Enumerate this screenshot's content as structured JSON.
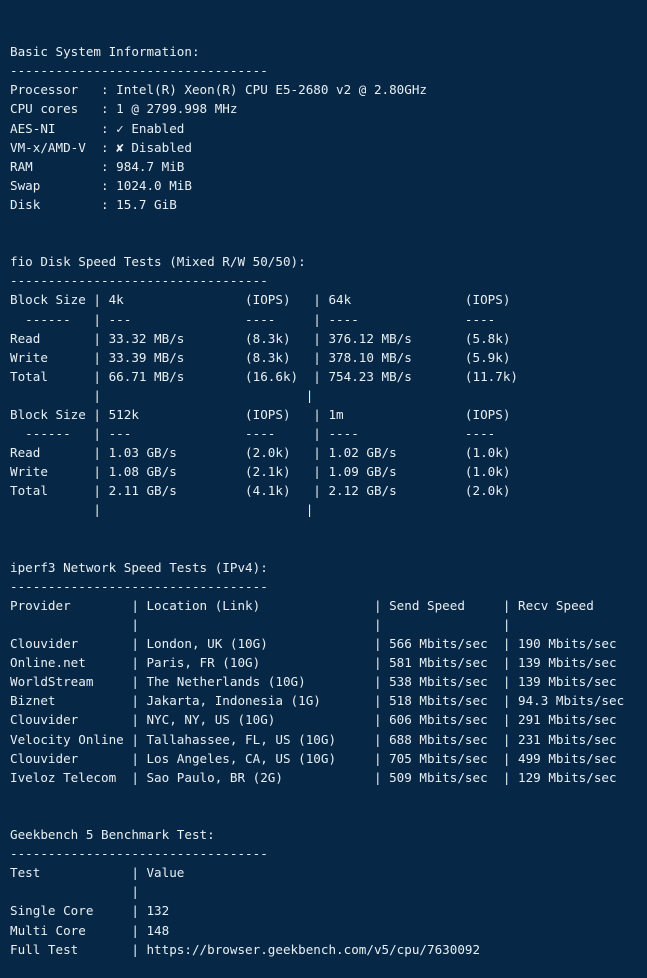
{
  "terminal": {
    "background_color": "#062846",
    "text_color": "#e9eff3",
    "rule_char": "-",
    "rule_length": 34,
    "pipe": "|"
  },
  "system_info": {
    "heading": "Basic System Information:",
    "rows": [
      {
        "label": "Processor",
        "value": "Intel(R) Xeon(R) CPU E5-2680 v2 @ 2.80GHz"
      },
      {
        "label": "CPU cores",
        "value": "1 @ 2799.998 MHz"
      },
      {
        "label": "AES-NI",
        "value": "Enabled",
        "glyph": "✓"
      },
      {
        "label": "VM-x/AMD-V",
        "value": "Disabled",
        "glyph": "✘"
      },
      {
        "label": "RAM",
        "value": "984.7 MiB"
      },
      {
        "label": "Swap",
        "value": "1024.0 MiB"
      },
      {
        "label": "Disk",
        "value": "15.7 GiB"
      }
    ]
  },
  "fio": {
    "heading": "fio Disk Speed Tests (Mixed R/W 50/50):",
    "blocks": [
      {
        "label_header": "Block Size",
        "col_a": "4k",
        "col_b": "64k",
        "iops_header": "(IOPS)",
        "dash_label": "------",
        "dash_a": "---",
        "dash_a_iops": "----",
        "dash_b": "----",
        "dash_b_iops": "----",
        "rows": [
          {
            "name": "Read",
            "a_speed": "33.32 MB/s",
            "a_iops": "(8.3k)",
            "b_speed": "376.12 MB/s",
            "b_iops": "(5.8k)"
          },
          {
            "name": "Write",
            "a_speed": "33.39 MB/s",
            "a_iops": "(8.3k)",
            "b_speed": "378.10 MB/s",
            "b_iops": "(5.9k)"
          },
          {
            "name": "Total",
            "a_speed": "66.71 MB/s",
            "a_iops": "(16.6k)",
            "b_speed": "754.23 MB/s",
            "b_iops": "(11.7k)"
          }
        ]
      },
      {
        "label_header": "Block Size",
        "col_a": "512k",
        "col_b": "1m",
        "iops_header": "(IOPS)",
        "dash_label": "------",
        "dash_a": "---",
        "dash_a_iops": "----",
        "dash_b": "----",
        "dash_b_iops": "----",
        "rows": [
          {
            "name": "Read",
            "a_speed": "1.03 GB/s",
            "a_iops": "(2.0k)",
            "b_speed": "1.02 GB/s",
            "b_iops": "(1.0k)"
          },
          {
            "name": "Write",
            "a_speed": "1.08 GB/s",
            "a_iops": "(2.1k)",
            "b_speed": "1.09 GB/s",
            "b_iops": "(1.0k)"
          },
          {
            "name": "Total",
            "a_speed": "2.11 GB/s",
            "a_iops": "(4.1k)",
            "b_speed": "2.12 GB/s",
            "b_iops": "(2.0k)"
          }
        ]
      }
    ]
  },
  "iperf": {
    "heading": "iperf3 Network Speed Tests (IPv4):",
    "columns": [
      "Provider",
      "Location (Link)",
      "Send Speed",
      "Recv Speed"
    ],
    "rows": [
      {
        "provider": "Clouvider",
        "location": "London, UK (10G)",
        "send": "566 Mbits/sec",
        "recv": "190 Mbits/sec"
      },
      {
        "provider": "Online.net",
        "location": "Paris, FR (10G)",
        "send": "581 Mbits/sec",
        "recv": "139 Mbits/sec"
      },
      {
        "provider": "WorldStream",
        "location": "The Netherlands (10G)",
        "send": "538 Mbits/sec",
        "recv": "139 Mbits/sec"
      },
      {
        "provider": "Biznet",
        "location": "Jakarta, Indonesia (1G)",
        "send": "518 Mbits/sec",
        "recv": "94.3 Mbits/sec"
      },
      {
        "provider": "Clouvider",
        "location": "NYC, NY, US (10G)",
        "send": "606 Mbits/sec",
        "recv": "291 Mbits/sec"
      },
      {
        "provider": "Velocity Online",
        "location": "Tallahassee, FL, US (10G)",
        "send": "688 Mbits/sec",
        "recv": "231 Mbits/sec"
      },
      {
        "provider": "Clouvider",
        "location": "Los Angeles, CA, US (10G)",
        "send": "705 Mbits/sec",
        "recv": "499 Mbits/sec"
      },
      {
        "provider": "Iveloz Telecom",
        "location": "Sao Paulo, BR (2G)",
        "send": "509 Mbits/sec",
        "recv": "129 Mbits/sec"
      }
    ]
  },
  "geekbench": {
    "heading": "Geekbench 5 Benchmark Test:",
    "columns": [
      "Test",
      "Value"
    ],
    "rows": [
      {
        "test": "Single Core",
        "value": "132"
      },
      {
        "test": "Multi Core",
        "value": "148"
      },
      {
        "test": "Full Test",
        "value": "https://browser.geekbench.com/v5/cpu/7630092"
      }
    ]
  }
}
